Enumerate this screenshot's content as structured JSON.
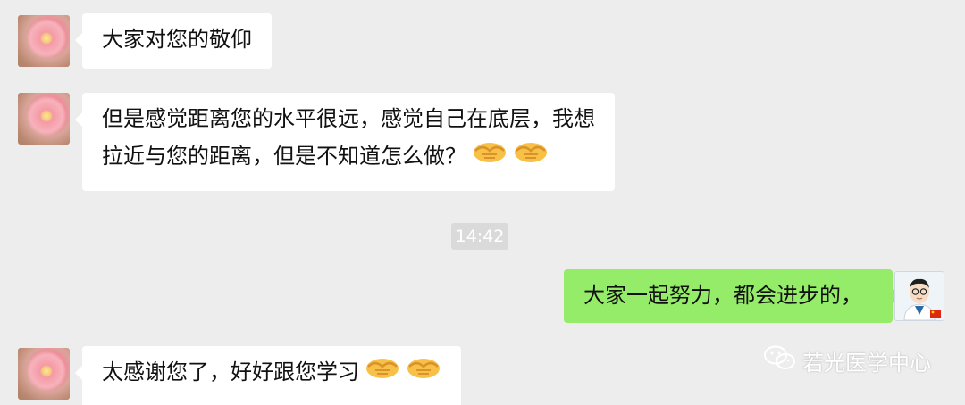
{
  "messages": [
    {
      "side": "left",
      "lines": [
        "大家对您的敬仰"
      ],
      "emoji": []
    },
    {
      "side": "left",
      "lines": [
        "但是感觉距离您的水平很远，感觉自己在底层，我想",
        "拉近与您的距离，但是不知道怎么做？"
      ],
      "emoji": [
        "handshake-icon",
        "handshake-icon"
      ]
    },
    {
      "side": "right",
      "lines": [
        "大家一起努力，都会进步的，"
      ],
      "emoji": []
    },
    {
      "side": "left",
      "lines": [
        "太感谢您了，好好跟您学习"
      ],
      "emoji": [
        "handshake-icon",
        "handshake-icon"
      ]
    }
  ],
  "timestamp": "14:42",
  "watermark": "若光医学中心",
  "colors": {
    "background": "#ededed",
    "bubble_other": "#ffffff",
    "bubble_self": "#95ec69",
    "timestamp_bg": "#dadada"
  }
}
